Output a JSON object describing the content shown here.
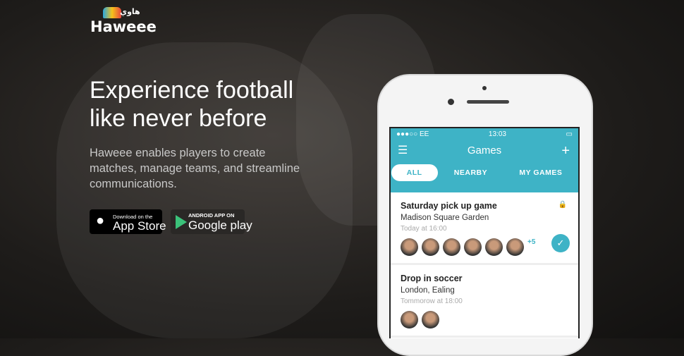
{
  "logo": {
    "name": "Haweee",
    "arabic": "هاوي"
  },
  "hero": {
    "title_line1": "Experience football",
    "title_line2": "like never before",
    "description": "Haweee enables players to create matches, manage teams, and streamline communications."
  },
  "badges": {
    "apple_small": "Download on the",
    "apple_big": "App Store",
    "google_small": "ANDROID APP ON",
    "google_big": "Google play"
  },
  "phone": {
    "status": {
      "carrier": "●●●○○ EE",
      "time": "13:03",
      "battery": "▭"
    },
    "title": "Games",
    "menu_icon": "☰",
    "add_icon": "+",
    "tabs": [
      "ALL",
      "NEARBY",
      "MY GAMES"
    ],
    "games": [
      {
        "title": "Saturday pick up game",
        "place": "Madison Square Garden",
        "time": "Today at 16:00",
        "more": "+5"
      },
      {
        "title": "Drop in soccer",
        "place": "London, Ealing",
        "time": "Tommorow at 18:00"
      }
    ]
  },
  "colors": {
    "accent": "#3eb3c6"
  }
}
